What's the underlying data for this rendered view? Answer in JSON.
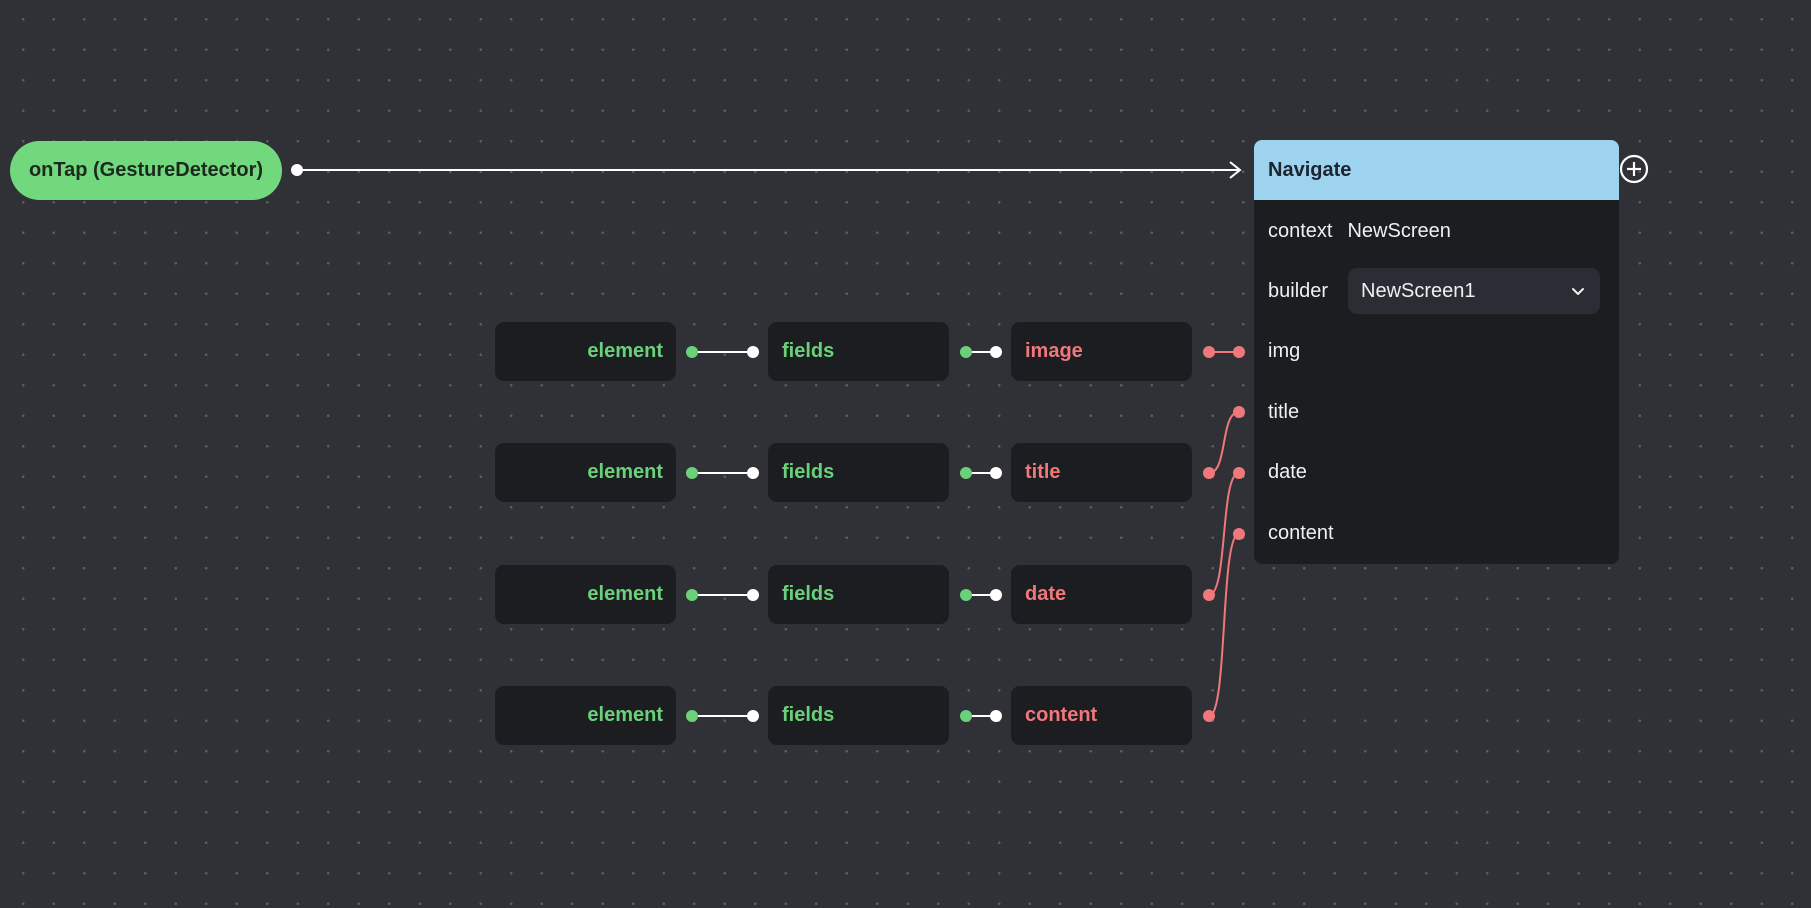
{
  "trigger": {
    "label": "onTap (GestureDetector)"
  },
  "rows": [
    {
      "element": "element",
      "fields": "fields",
      "field": "image"
    },
    {
      "element": "element",
      "fields": "fields",
      "field": "title"
    },
    {
      "element": "element",
      "fields": "fields",
      "field": "date"
    },
    {
      "element": "element",
      "fields": "fields",
      "field": "content"
    }
  ],
  "navigate": {
    "title": "Navigate",
    "context_label": "context",
    "context_value": "NewScreen",
    "builder_label": "builder",
    "builder_value": "NewScreen1",
    "params": [
      "img",
      "title",
      "date",
      "content"
    ]
  },
  "icons": {
    "add": "add-circle-icon",
    "dropdown": "chevron-down-icon"
  },
  "colors": {
    "canvas": "#2f3137",
    "node_bg": "#1b1d21",
    "trigger": "#72d87e",
    "header": "#9dd3ee",
    "green_port": "#6ad17a",
    "red_port": "#f0777a",
    "white_port": "#ffffff"
  }
}
